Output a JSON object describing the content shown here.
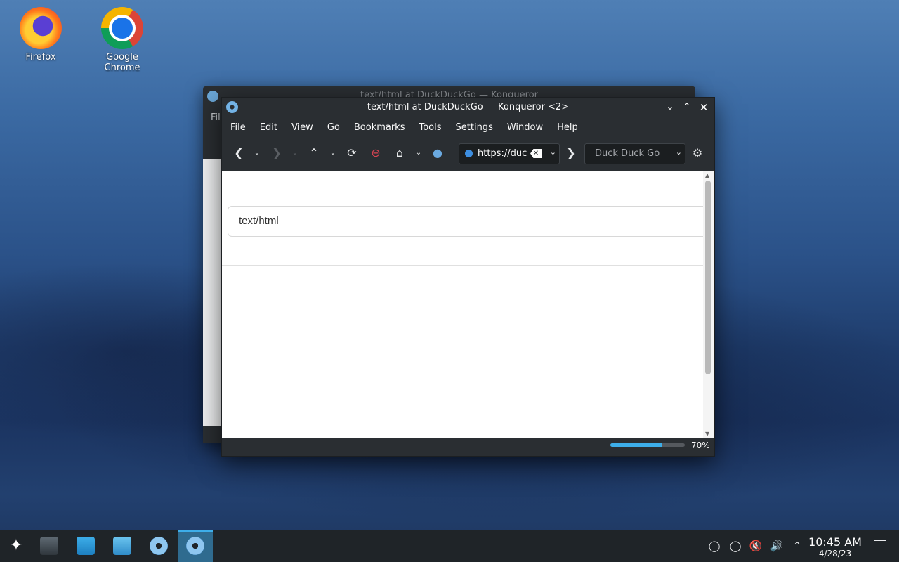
{
  "desktop": {
    "icons": [
      {
        "label": "Firefox"
      },
      {
        "label": "Google Chrome"
      }
    ]
  },
  "back_window": {
    "title": "text/html at DuckDuckGo — Konqueror",
    "menu_first": "Fil"
  },
  "window": {
    "title": "text/html at DuckDuckGo — Konqueror <2>",
    "menu": [
      "File",
      "Edit",
      "View",
      "Go",
      "Bookmarks",
      "Tools",
      "Settings",
      "Window",
      "Help"
    ],
    "url": "https://duckduckgo.com",
    "search_engine": "Duck Duck Go",
    "page": {
      "query_text": "text/html"
    },
    "status": {
      "progress_fraction": 0.7,
      "progress_label": "70%"
    }
  },
  "taskbar": {
    "clock_time": "10:45 AM",
    "clock_date": "4/28/23"
  }
}
